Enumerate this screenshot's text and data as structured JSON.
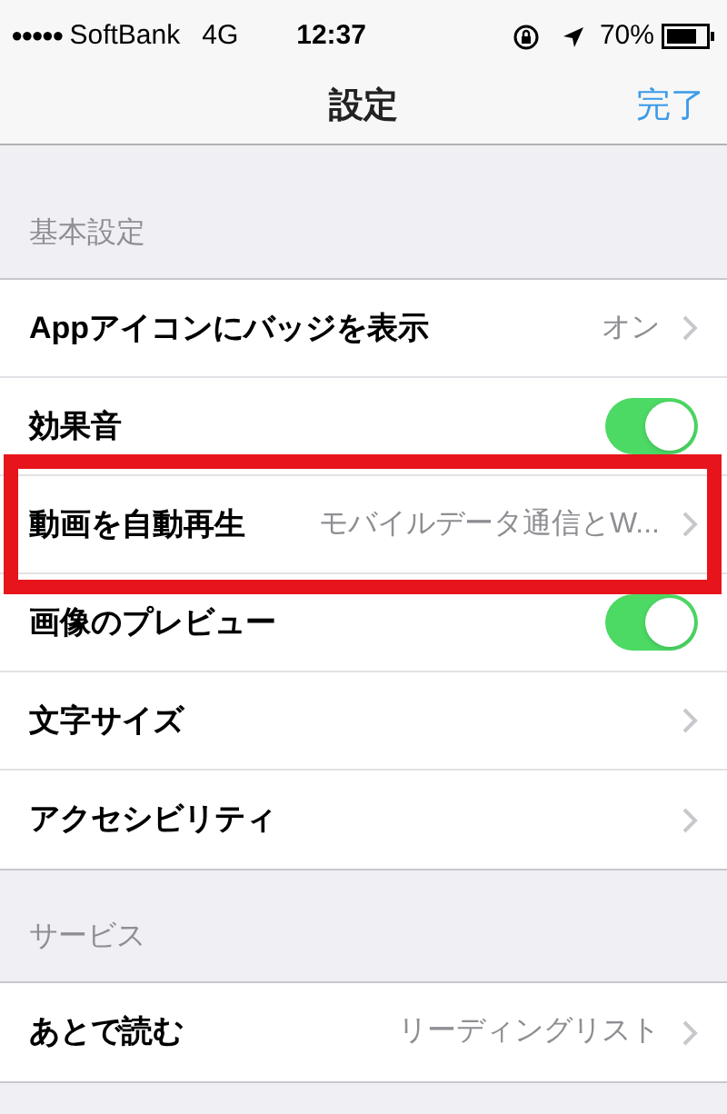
{
  "status_bar": {
    "signal": "●●●●●",
    "carrier": "SoftBank",
    "network": "4G",
    "time": "12:37",
    "battery": "70%"
  },
  "nav": {
    "title": "設定",
    "done": "完了"
  },
  "sections": [
    {
      "header": "基本設定",
      "rows": [
        {
          "kind": "link",
          "label": "Appアイコンにバッジを表示",
          "value": "オン",
          "highlighted": false
        },
        {
          "kind": "toggle",
          "label": "効果音",
          "on": true,
          "highlighted": false
        },
        {
          "kind": "link",
          "label": "動画を自動再生",
          "value": "モバイルデータ通信とW...",
          "highlighted": true
        },
        {
          "kind": "toggle",
          "label": "画像のプレビュー",
          "on": true,
          "highlighted": false
        },
        {
          "kind": "link",
          "label": "文字サイズ",
          "highlighted": false
        },
        {
          "kind": "link",
          "label": "アクセシビリティ",
          "highlighted": false
        }
      ]
    },
    {
      "header": "サービス",
      "rows": [
        {
          "kind": "link",
          "label": "あとで読む",
          "value": "リーディングリスト",
          "highlighted": false
        }
      ]
    }
  ]
}
